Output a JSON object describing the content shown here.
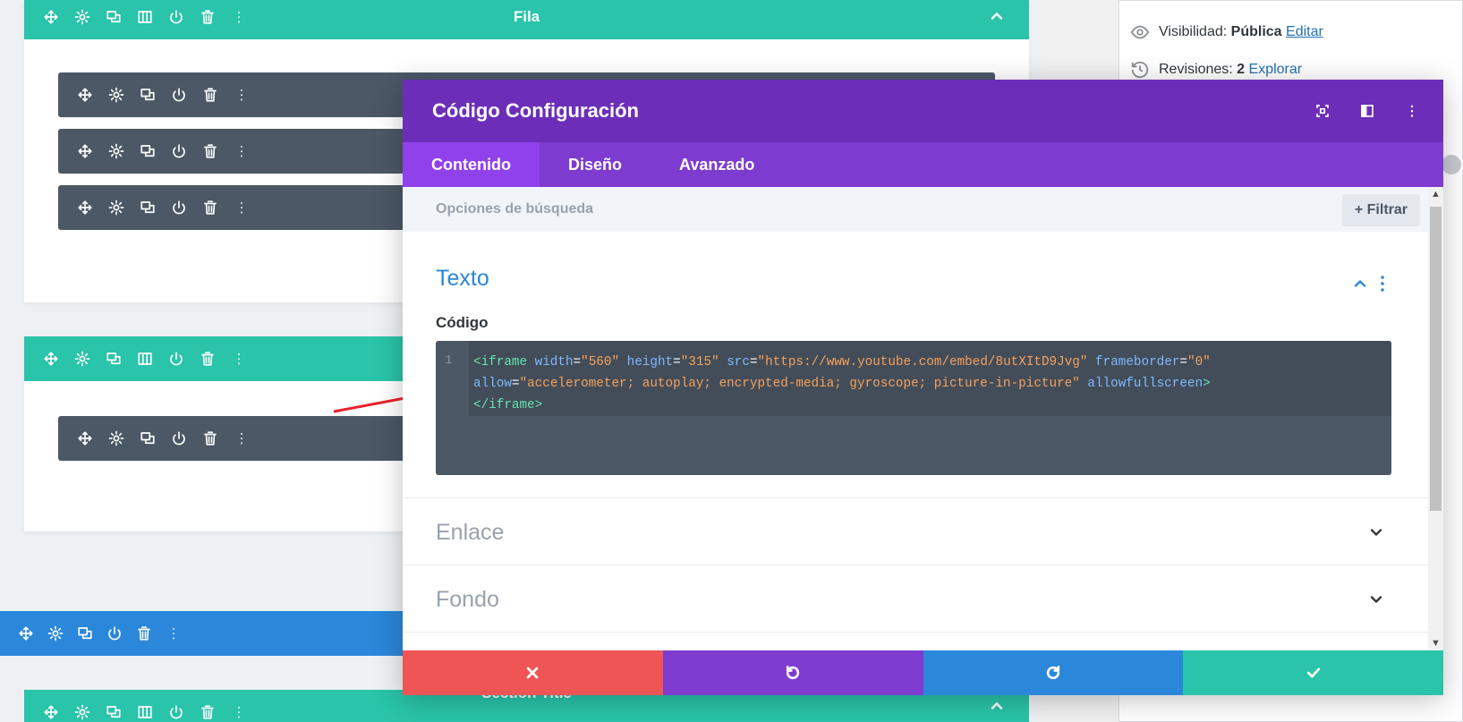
{
  "builder": {
    "row_top_label": "Fila",
    "section_bottom_label": "Section Title"
  },
  "sidebar": {
    "visibility_label": "Visibilidad:",
    "visibility_value": "Pública",
    "visibility_edit": "Editar",
    "revisions_label": "Revisiones:",
    "revisions_value": "2",
    "revisions_link": "Explorar"
  },
  "modal": {
    "title": "Código Configuración",
    "tabs": [
      {
        "label": "Contenido"
      },
      {
        "label": "Diseño"
      },
      {
        "label": "Avanzado"
      }
    ],
    "search_placeholder": "Opciones de búsqueda",
    "filter_label": "+ Filtrar",
    "sections": {
      "texto": "Texto",
      "enlace": "Enlace",
      "fondo": "Fondo"
    },
    "code_field_label": "Código",
    "code_line_number": "1",
    "code": {
      "t1": "<iframe",
      "a1": " width",
      "e1": "=",
      "s1": "\"560\"",
      "a2": " height",
      "e2": "=",
      "s2": "\"315\"",
      "a3": " src",
      "e3": "=",
      "s3": "\"https://www.youtube.com/embed/8utXItD9Jvg\"",
      "a4": " frameborder",
      "e4": "=",
      "s4": "\"0\"",
      "a5": "allow",
      "e5": "=",
      "s5": "\"accelerometer; autoplay; encrypted-media; gyroscope; picture-in-picture\"",
      "a6": " allowfullscreen",
      "t2": ">",
      "t3": "</iframe>"
    }
  },
  "colors": {
    "teal": "#29c4a9",
    "purple_head": "#6c2eb9",
    "purple_tabs": "#7e3bd0",
    "blue": "#2b87da",
    "red": "#ef5555",
    "slate": "#4c5866"
  },
  "icons": [
    "move-icon",
    "gear-icon",
    "duplicate-icon",
    "columns-icon",
    "power-icon",
    "trash-icon",
    "more-icon",
    "chevron-up-icon",
    "chevron-down-icon",
    "close-icon",
    "undo-icon",
    "redo-icon",
    "check-icon"
  ]
}
